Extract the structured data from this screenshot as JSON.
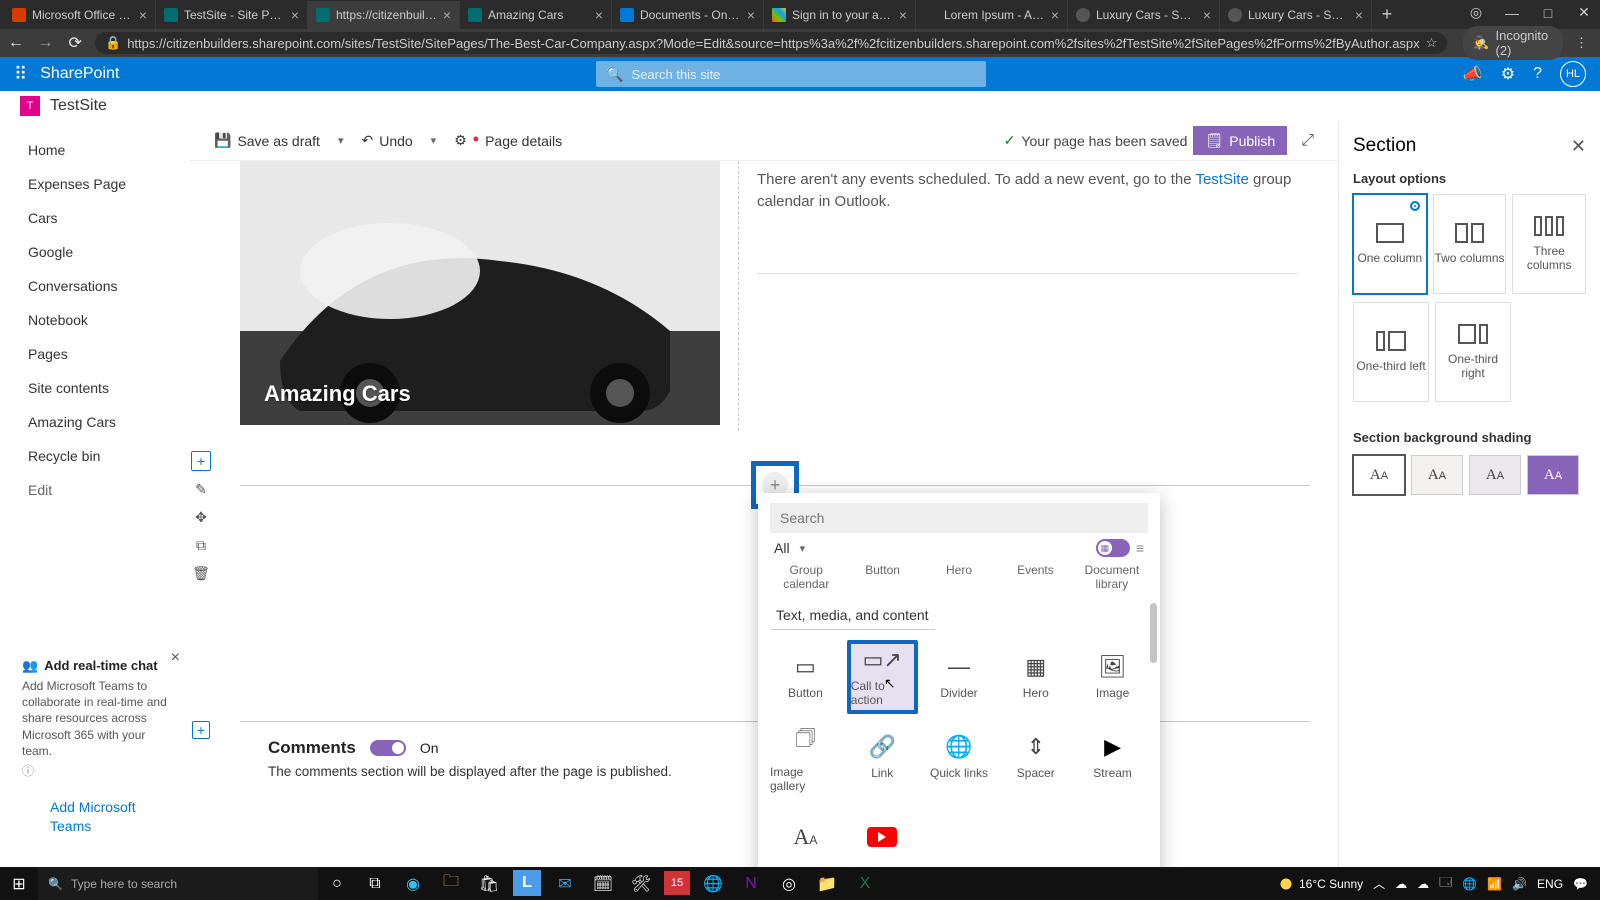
{
  "browser": {
    "tabs": [
      {
        "title": "Microsoft Office Home",
        "fav": "O"
      },
      {
        "title": "TestSite - Site Pages -",
        "fav": "S"
      },
      {
        "title": "https://citizenbuilders",
        "fav": "S",
        "active": true
      },
      {
        "title": "Amazing Cars",
        "fav": "S"
      },
      {
        "title": "Documents - OneDrive",
        "fav": "☁"
      },
      {
        "title": "Sign in to your account",
        "fav": "⊞"
      },
      {
        "title": "Lorem Ipsum - All the",
        "fav": ""
      },
      {
        "title": "Luxury Cars - Sedans,",
        "fav": "⊙"
      },
      {
        "title": "Luxury Cars - Sedans,",
        "fav": "⊙"
      }
    ],
    "url": "https://citizenbuilders.sharepoint.com/sites/TestSite/SitePages/The-Best-Car-Company.aspx?Mode=Edit&source=https%3a%2f%2fcitizenbuilders.sharepoint.com%2fsites%2fTestSite%2fSitePages%2fForms%2fByAuthor.aspx",
    "incognito": "Incognito (2)"
  },
  "suite": {
    "brand": "SharePoint",
    "search_ph": "Search this site",
    "avatar": "HL"
  },
  "site": {
    "name": "TestSite",
    "logo": "T"
  },
  "nav": {
    "items": [
      "Home",
      "Expenses Page",
      "Cars",
      "Google",
      "Conversations",
      "Notebook",
      "Pages",
      "Site contents",
      "Amazing Cars",
      "Recycle bin",
      "Edit"
    ]
  },
  "teams": {
    "title": "Add real-time chat",
    "body": "Add Microsoft Teams to collaborate in real-time and share resources across Microsoft 365 with your team.",
    "link": "Add Microsoft Teams"
  },
  "cmdbar": {
    "save": "Save as draft",
    "undo": "Undo",
    "details": "Page details",
    "saved": "Your page has been saved",
    "publish": "Publish"
  },
  "hero": {
    "caption": "Amazing Cars"
  },
  "events": {
    "pre": "There aren't any events scheduled. To add a new event, go to the ",
    "link": "TestSite",
    "post": " group calendar in Outlook."
  },
  "toolbox": {
    "search_ph": "Search",
    "filter": "All",
    "partial": [
      "Group calendar",
      "Button",
      "Hero",
      "Events",
      "Document library"
    ],
    "section": "Text, media, and content",
    "row1": [
      {
        "label": "Button",
        "icon": "▭"
      },
      {
        "label": "Call to action",
        "icon": "▭",
        "sel": true
      },
      {
        "label": "Divider",
        "icon": "—"
      },
      {
        "label": "Hero",
        "icon": "▦"
      },
      {
        "label": "Image",
        "icon": "🖼"
      }
    ],
    "row2": [
      {
        "label": "Image gallery",
        "icon": "🗇"
      },
      {
        "label": "Link",
        "icon": "🔗"
      },
      {
        "label": "Quick links",
        "icon": "⊕"
      },
      {
        "label": "Spacer",
        "icon": "⇕"
      },
      {
        "label": "Stream",
        "icon": "▶"
      }
    ],
    "row3": [
      {
        "label": "",
        "icon": "A"
      },
      {
        "label": "",
        "icon": "yt"
      }
    ]
  },
  "comments": {
    "title": "Comments",
    "state": "On",
    "note": "The comments section will be displayed after the page is published."
  },
  "rpanel": {
    "title": "Section",
    "layout_head": "Layout options",
    "layouts": [
      "One column",
      "Two columns",
      "Three columns",
      "One-third left",
      "One-third right"
    ],
    "shade_head": "Section background shading"
  },
  "taskbar": {
    "search_ph": "Type here to search",
    "weather": "16°C  Sunny",
    "lang": "ENG"
  }
}
